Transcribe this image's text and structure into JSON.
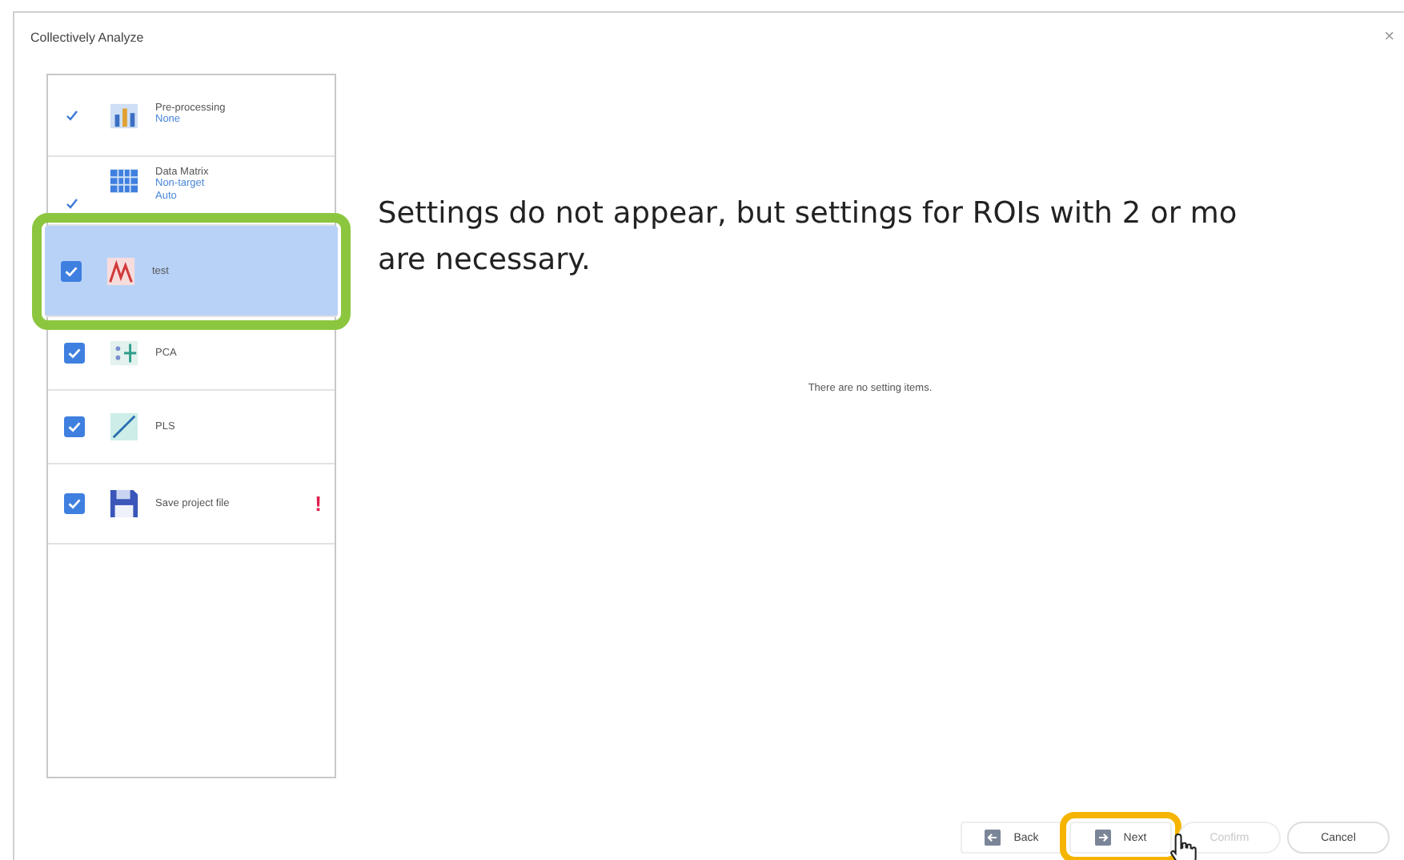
{
  "window": {
    "title": "Collectively Analyze",
    "close": "×"
  },
  "steps": [
    {
      "kind": "done",
      "label": "Pre-processing",
      "details": [
        "None"
      ],
      "selected": false
    },
    {
      "kind": "done",
      "label": "Data Matrix",
      "details": [
        "Non-target",
        "Auto"
      ],
      "selected": false
    },
    {
      "kind": "checkbox",
      "checked": true,
      "label": "test",
      "selected": true
    },
    {
      "kind": "checkbox",
      "checked": true,
      "label": "PCA",
      "selected": false
    },
    {
      "kind": "checkbox",
      "checked": true,
      "label": "PLS",
      "selected": false
    },
    {
      "kind": "checkbox",
      "checked": true,
      "label": "Save project file",
      "selected": false,
      "warning": "!"
    }
  ],
  "annotation": "Settings do not appear, but settings for ROIs with 2 or mo are necessary.",
  "empty_message": "There are no setting items.",
  "buttons": [
    {
      "kind": "back",
      "label": "Back",
      "disabled": false,
      "highlighted": false
    },
    {
      "kind": "next",
      "label": "Next",
      "disabled": false,
      "highlighted": true
    },
    {
      "kind": "plain",
      "label": "Confirm",
      "disabled": true,
      "highlighted": false
    },
    {
      "kind": "plain",
      "label": "Cancel",
      "disabled": false,
      "highlighted": false
    }
  ]
}
